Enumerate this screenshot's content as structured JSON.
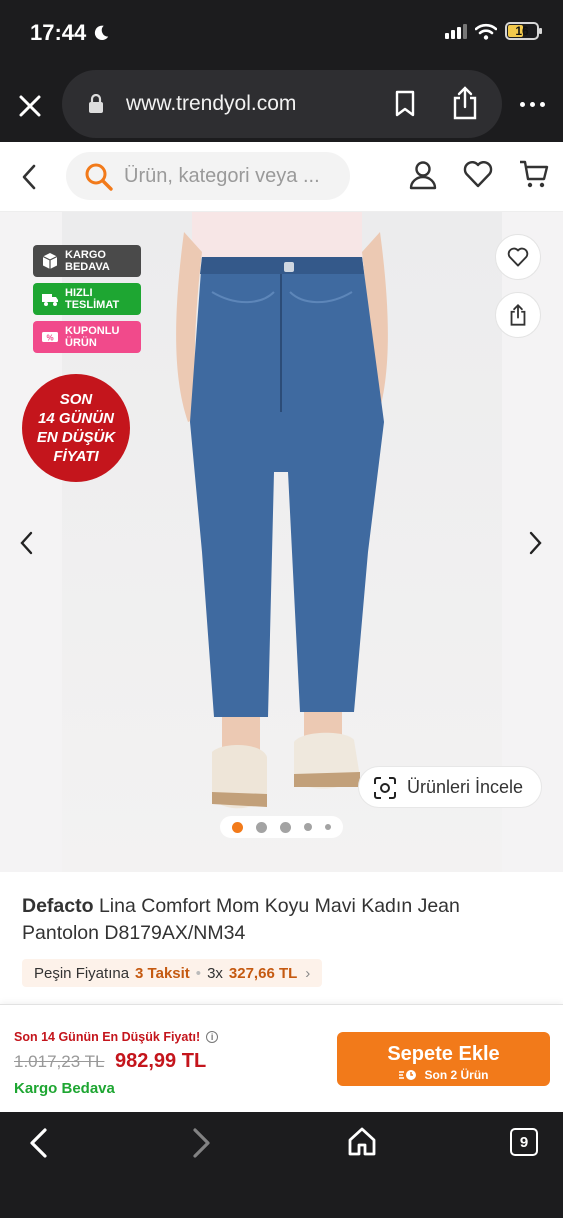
{
  "status_bar": {
    "time": "17:44",
    "battery": "16"
  },
  "browser": {
    "url": "www.trendyol.com"
  },
  "search": {
    "placeholder": "Ürün, kategori veya ..."
  },
  "badges": [
    {
      "line1": "KARGO",
      "line2": "BEDAVA",
      "icon": "box-icon",
      "color": "#4a4a4a"
    },
    {
      "line1": "HIZLI",
      "line2": "TESLİMAT",
      "icon": "truck-icon",
      "color": "#1ea632"
    },
    {
      "line1": "KUPONLU",
      "line2": "ÜRÜN",
      "icon": "coupon-icon",
      "color": "#f14a8b"
    }
  ],
  "lowest_price_sticker": {
    "line1": "SON",
    "line2": "14 GÜNÜN",
    "line3": "EN DÜŞÜK",
    "line4": "FİYATI"
  },
  "gallery": {
    "inspect_label": "Ürünleri İncele",
    "active_slide": 1,
    "slide_count": 5
  },
  "product": {
    "brand": "Defacto",
    "name": "Lina Comfort Mom Koyu Mavi Kadın Jean Pantolon D8179AX/NM34"
  },
  "installments": {
    "prefix": "Peşin Fiyatına",
    "count_label": "3 Taksit",
    "sep": "•",
    "times": "3x",
    "amount": "327,66 TL",
    "chevron": "›"
  },
  "buy_bar": {
    "lowest_notice": "Son 14 Günün En Düşük Fiyatı!",
    "old_price": "1.017,23 TL",
    "new_price": "982,99 TL",
    "shipping": "Kargo Bedava",
    "add_to_cart": "Sepete Ekle",
    "stock_note": "Son 2 Ürün"
  },
  "toolbar": {
    "tab_count": "9"
  },
  "colors": {
    "brand_orange": "#f27a1a",
    "discount_red": "#c4151c",
    "free_shipping_green": "#1ea632"
  }
}
